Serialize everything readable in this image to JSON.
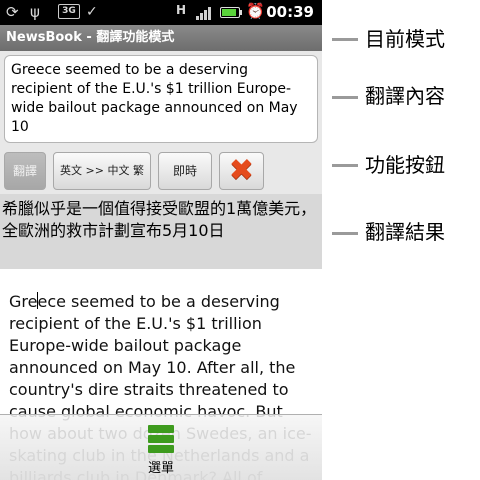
{
  "status_bar": {
    "network_badge": "3G",
    "data_indicator": "H",
    "time": "00:39",
    "battery_level": 0.9,
    "signal_level": 4,
    "icons": [
      "sync-icon",
      "usb-icon",
      "3g-icon",
      "check-icon",
      "h-data-icon",
      "signal-icon",
      "battery-icon",
      "alarm-icon"
    ]
  },
  "title_bar": {
    "app_name": "NewsBook",
    "separator": " - ",
    "mode": "翻譯功能模式"
  },
  "input": {
    "value": "Greece seemed to be a deserving recipient of the E.U.'s $1 trillion Europe-wide bailout package announced on May 10"
  },
  "buttons": {
    "translate": "翻譯",
    "language": "英文 >> 中文 繁",
    "realtime": "即時",
    "clear_icon": "clear-x-icon"
  },
  "result": {
    "text": "希臘似乎是一個值得接受歐盟的1萬億美元，全歐洲的救市計劃宣布5月10日"
  },
  "content": {
    "text_before_cursor": "Gre",
    "text_after_cursor": "ece seemed to be a deserving recipient of the E.U.'s $1 trillion Europe-wide bailout package announced on May 10. After all, the country's dire straits threatened to cause global economic havoc. But how about two dozen Swedes, an ice-skating club in the Netherlands and a billiards club in Denmark? All of"
  },
  "menu": {
    "label": "選單",
    "icon": "menu-grid-icon"
  },
  "legend": {
    "current_mode": "目前模式",
    "translate_content": "翻譯內容",
    "function_buttons": "功能按鈕",
    "translate_result": "翻譯結果"
  },
  "colors": {
    "status_bar": "#000000",
    "title_bar": "#7b7b7b",
    "button_panel": "#e8e8e8",
    "result_panel": "#d8d8d8",
    "battery": "#5ad33b",
    "clear_icon": "#e54b1c",
    "menu_icon": "#3e9b1e",
    "legend_line": "#9a9a9a"
  }
}
